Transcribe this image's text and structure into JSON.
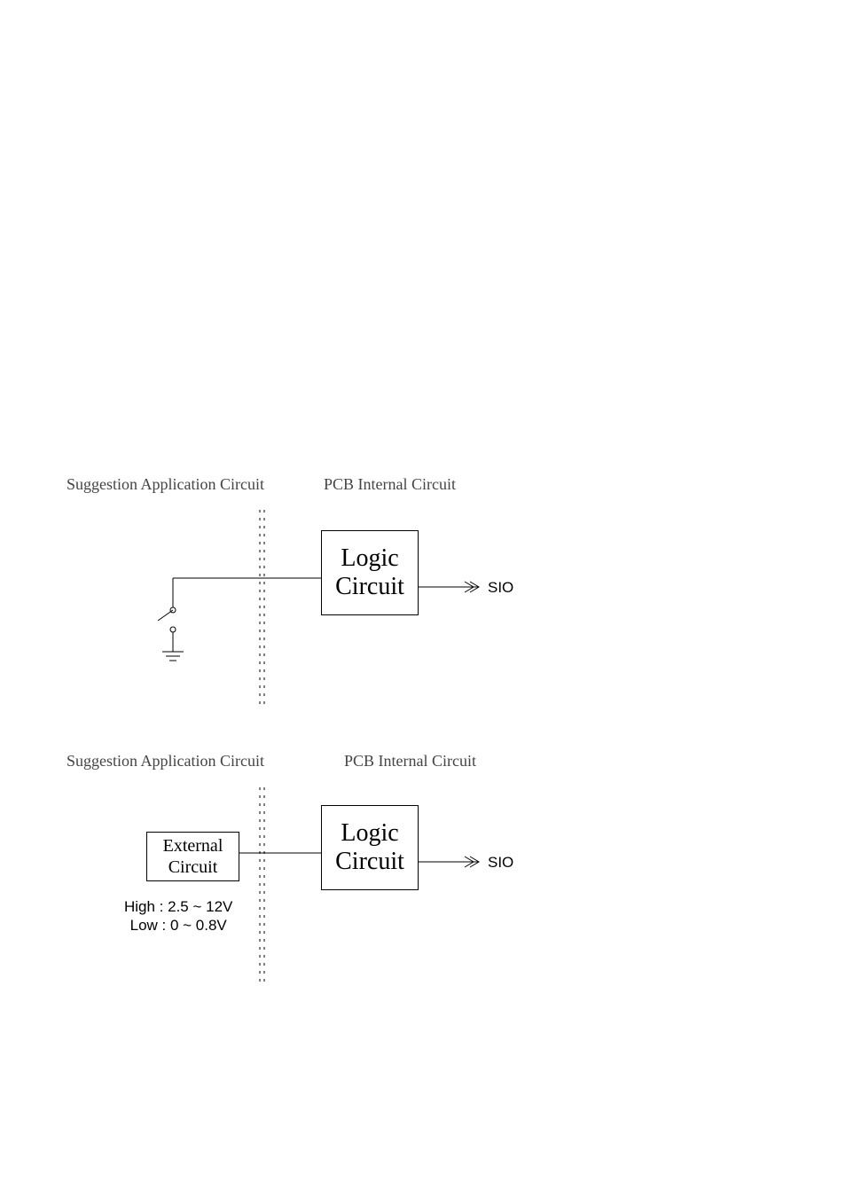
{
  "diagram1": {
    "left_label": "Suggestion Application Circuit",
    "right_label": "PCB Internal Circuit",
    "logic_line1": "Logic",
    "logic_line2": "Circuit",
    "output": "SIO"
  },
  "diagram2": {
    "left_label": "Suggestion Application Circuit",
    "right_label": "PCB Internal Circuit",
    "logic_line1": "Logic",
    "logic_line2": "Circuit",
    "ext_line1": "External",
    "ext_line2": "Circuit",
    "volt_high": "High : 2.5 ~ 12V",
    "volt_low": "Low : 0 ~ 0.8V",
    "output": "SIO"
  }
}
